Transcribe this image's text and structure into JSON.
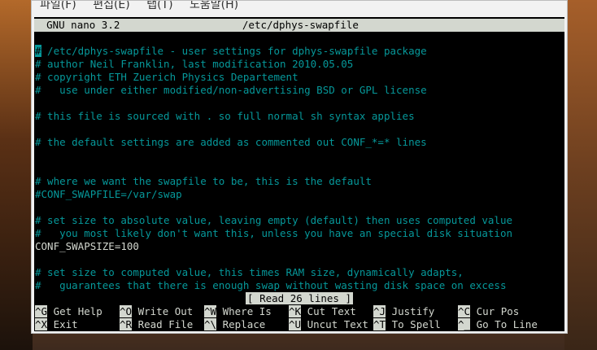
{
  "menubar": {
    "items": [
      "파일(F)",
      "편집(E)",
      "탭(T)",
      "도움말(H)"
    ]
  },
  "nano": {
    "version_label": "GNU nano 3.2",
    "filename": "/etc/dphys-swapfile"
  },
  "file_lines": [
    {
      "text": "/etc/dphys-swapfile - user settings for dphys-swapfile package",
      "prefix": "#",
      "type": "comment"
    },
    {
      "text": "# author Neil Franklin, last modification 2010.05.05",
      "type": "comment"
    },
    {
      "text": "# copyright ETH Zuerich Physics Departement",
      "type": "comment"
    },
    {
      "text": "#   use under either modified/non-advertising BSD or GPL license",
      "type": "comment"
    },
    {
      "text": "",
      "type": "blank"
    },
    {
      "text": "# this file is sourced with . so full normal sh syntax applies",
      "type": "comment"
    },
    {
      "text": "",
      "type": "blank"
    },
    {
      "text": "# the default settings are added as commented out CONF_*=* lines",
      "type": "comment"
    },
    {
      "text": "",
      "type": "blank"
    },
    {
      "text": "",
      "type": "blank"
    },
    {
      "text": "# where we want the swapfile to be, this is the default",
      "type": "comment"
    },
    {
      "text": "#CONF_SWAPFILE=/var/swap",
      "type": "comment"
    },
    {
      "text": "",
      "type": "blank"
    },
    {
      "text": "# set size to absolute value, leaving empty (default) then uses computed value",
      "type": "comment"
    },
    {
      "text": "#   you most likely don't want this, unless you have an special disk situation",
      "type": "comment"
    },
    {
      "text": "CONF_SWAPSIZE=100",
      "type": "normal"
    },
    {
      "text": "",
      "type": "blank"
    },
    {
      "text": "# set size to computed value, this times RAM size, dynamically adapts,",
      "type": "comment"
    },
    {
      "text": "#   guarantees that there is enough swap without wasting disk space on excess",
      "type": "comment"
    }
  ],
  "status_message": "[ Read 26 lines ]",
  "shortcuts": [
    [
      {
        "key": "^G",
        "label": "Get Help"
      },
      {
        "key": "^O",
        "label": "Write Out"
      },
      {
        "key": "^W",
        "label": "Where Is"
      },
      {
        "key": "^K",
        "label": "Cut Text"
      },
      {
        "key": "^J",
        "label": "Justify"
      },
      {
        "key": "^C",
        "label": "Cur Pos"
      }
    ],
    [
      {
        "key": "^X",
        "label": "Exit"
      },
      {
        "key": "^R",
        "label": "Read File"
      },
      {
        "key": "^\\",
        "label": "Replace"
      },
      {
        "key": "^U",
        "label": "Uncut Text"
      },
      {
        "key": "^T",
        "label": "To Spell"
      },
      {
        "key": "^_",
        "label": "Go To Line"
      }
    ]
  ],
  "colors": {
    "comment": "#06989a",
    "normal_text": "#d3d7cf",
    "terminal_bg": "#000000",
    "inverse_bg": "#d3d7cf"
  }
}
